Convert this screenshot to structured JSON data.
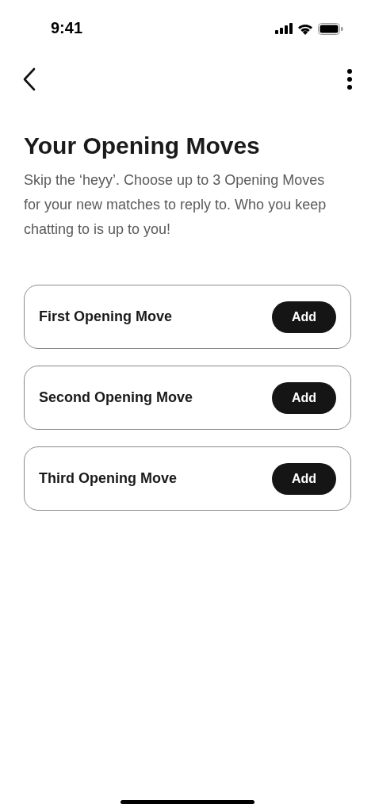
{
  "status_bar": {
    "time": "9:41"
  },
  "title": "Your Opening Moves",
  "description": "Skip the ‘heyy’. Choose up to 3 Opening Moves for your new matches to reply to. Who you keep chatting to is up to you!",
  "moves": [
    {
      "label": "First Opening Move",
      "button": "Add"
    },
    {
      "label": "Second Opening Move",
      "button": "Add"
    },
    {
      "label": "Third Opening Move",
      "button": "Add"
    }
  ]
}
